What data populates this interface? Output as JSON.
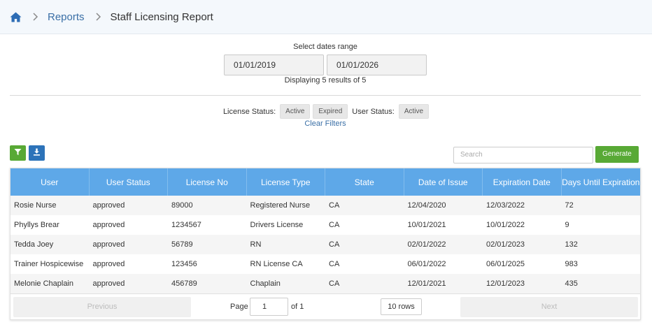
{
  "breadcrumb": {
    "home_icon": "home-icon",
    "items": [
      "Reports",
      "Staff Licensing Report"
    ]
  },
  "date_range": {
    "label": "Select dates range",
    "start": "01/01/2019",
    "end": "01/01/2026",
    "display_text": "Displaying 5 results of 5"
  },
  "filters": {
    "license_status_label": "License Status:",
    "license_status_chips": [
      "Active",
      "Expired"
    ],
    "user_status_label": "User Status:",
    "user_status_chips": [
      "Active"
    ],
    "clear_label": "Clear Filters"
  },
  "toolbar": {
    "filter_icon": "filter-icon",
    "download_icon": "download-icon",
    "search_placeholder": "Search",
    "generate_label": "Generate"
  },
  "colors": {
    "header_blue": "#5ea8e8",
    "green": "#58a935",
    "blue": "#2d73b9",
    "link": "#3a6fa6"
  },
  "table": {
    "columns": [
      "User",
      "User Status",
      "License No",
      "License Type",
      "State",
      "Date of Issue",
      "Expiration Date",
      "Days Until Expiration"
    ],
    "rows": [
      [
        "Rosie Nurse",
        "approved",
        "89000",
        "Registered Nurse",
        "CA",
        "12/04/2020",
        "12/03/2022",
        "72"
      ],
      [
        "Phyllys Brear",
        "approved",
        "1234567",
        "Drivers License",
        "CA",
        "10/01/2021",
        "10/01/2022",
        "9"
      ],
      [
        "Tedda Joey",
        "approved",
        "56789",
        "RN",
        "CA",
        "02/01/2022",
        "02/01/2023",
        "132"
      ],
      [
        "Trainer Hospicewise",
        "approved",
        "123456",
        "RN License CA",
        "CA",
        "06/01/2022",
        "06/01/2025",
        "983"
      ],
      [
        "Melonie Chaplain",
        "approved",
        "456789",
        "Chaplain",
        "CA",
        "12/01/2021",
        "12/01/2023",
        "435"
      ]
    ]
  },
  "pagination": {
    "previous_label": "Previous",
    "next_label": "Next",
    "page_label": "Page",
    "page_value": "1",
    "of_label": "of 1",
    "rows_label": "10 rows"
  }
}
